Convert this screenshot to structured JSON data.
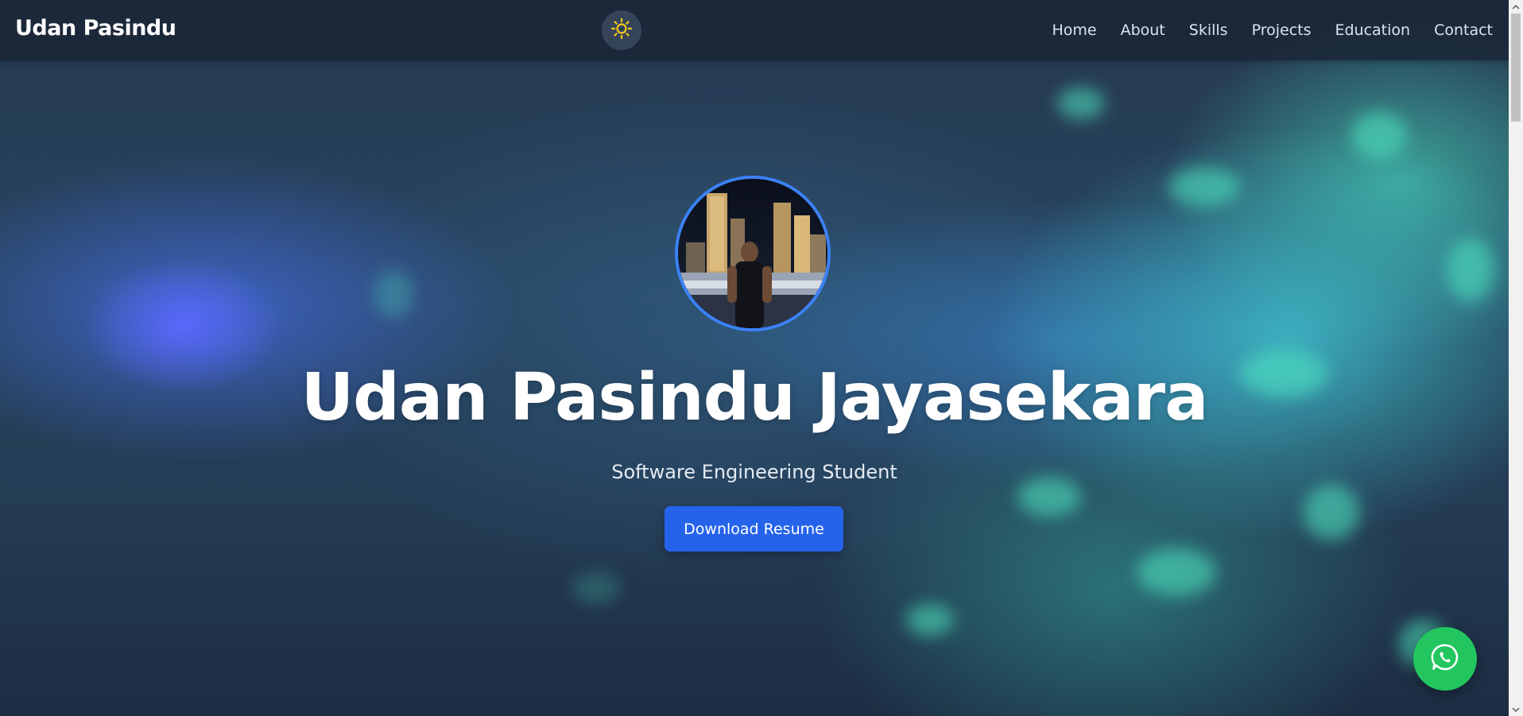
{
  "navbar": {
    "brand": "Udan Pasindu",
    "theme_toggle_icon": "sun-icon",
    "links": [
      {
        "label": "Home"
      },
      {
        "label": "About"
      },
      {
        "label": "Skills"
      },
      {
        "label": "Projects"
      },
      {
        "label": "Education"
      },
      {
        "label": "Contact"
      }
    ]
  },
  "hero": {
    "avatar_icon": "profile-photo",
    "title": "Udan Pasindu Jayasekara",
    "subtitle": "Software Engineering Student",
    "cta_label": "Download Resume"
  },
  "floating": {
    "whatsapp_icon": "whatsapp-icon"
  },
  "colors": {
    "accent": "#2563eb",
    "avatar_border": "#3b82f6",
    "whatsapp": "#22c55e",
    "sun": "#facc15"
  }
}
